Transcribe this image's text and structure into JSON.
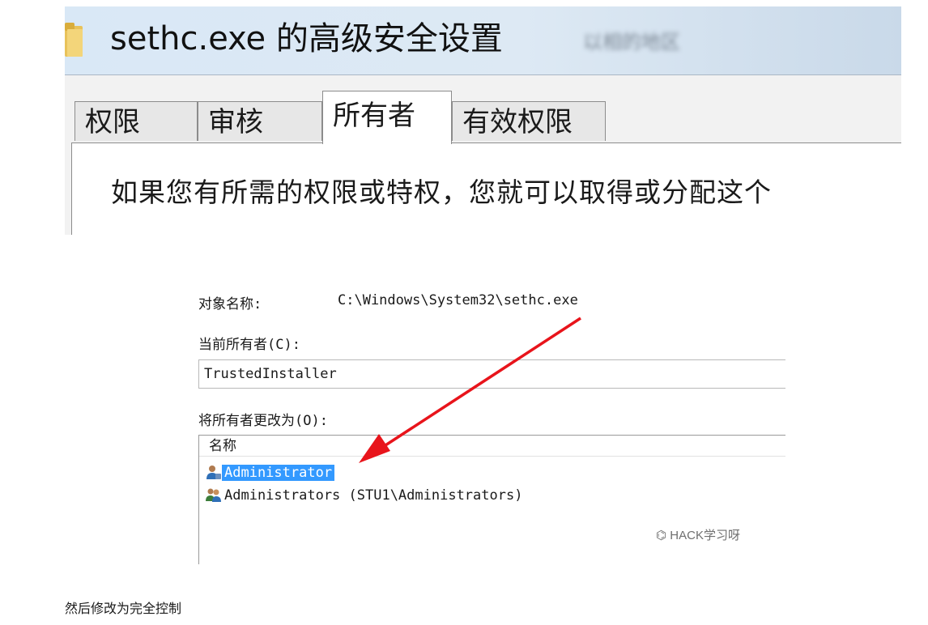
{
  "dialog": {
    "title": "sethc.exe 的高级安全设置",
    "title_blurred_text": "以相的地区",
    "tabs": [
      {
        "label": "权限",
        "active": false
      },
      {
        "label": "审核",
        "active": false
      },
      {
        "label": "所有者",
        "active": true
      },
      {
        "label": "有效权限",
        "active": false
      }
    ],
    "info_text": "如果您有所需的权限或特权，您就可以取得或分配这个"
  },
  "owner_dialog": {
    "object_name_label": "对象名称:",
    "object_name_value": "C:\\Windows\\System32\\sethc.exe",
    "current_owner_label": "当前所有者(C):",
    "current_owner_value": "TrustedInstaller",
    "change_owner_label": "将所有者更改为(O):",
    "list_header": "名称",
    "list_items": [
      {
        "name": "Administrator",
        "icon": "user-icon",
        "selected": true
      },
      {
        "name": "Administrators (STU1\\Administrators)",
        "icon": "group-icon",
        "selected": false
      }
    ],
    "watermark": "HACK学习呀"
  },
  "annotation": {
    "arrow_color": "#e8141b"
  },
  "caption": "然后修改为完全控制",
  "colors": {
    "selection": "#3399ff",
    "titlebar": "#dae7f4"
  }
}
